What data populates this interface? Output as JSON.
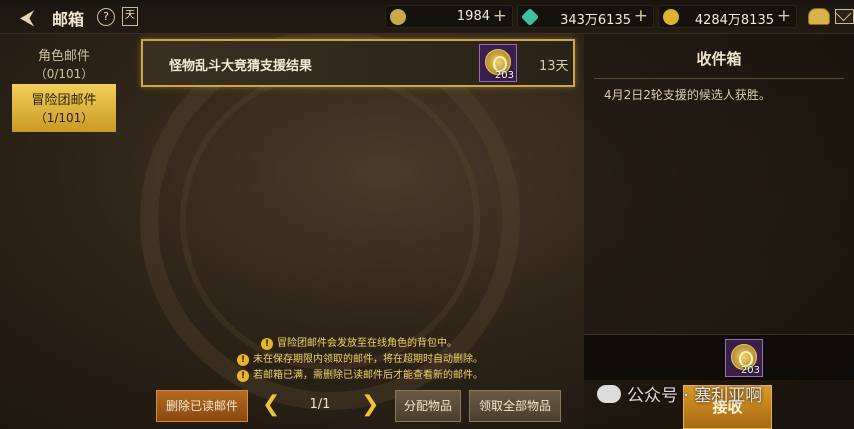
{
  "header": {
    "title": "邮箱",
    "help_icon": "question-icon",
    "calendar_icon": "calendar-icon",
    "calendar_glyph": "天",
    "resources": [
      {
        "icon": "c-token-icon",
        "value": "1984",
        "color": "#c9a84a"
      },
      {
        "icon": "crystal-icon",
        "value": "343万6135",
        "color": "#3fc0a0"
      },
      {
        "icon": "gold-coin-icon",
        "value": "4284万8135",
        "color": "#e0b030"
      }
    ]
  },
  "tabs": [
    {
      "label": "角色邮件",
      "count": "（0/101）",
      "selected": false
    },
    {
      "label": "冒险团邮件",
      "count": "（1/101）",
      "selected": true
    }
  ],
  "mails": [
    {
      "subject": "怪物乱斗大竞猜支援结果",
      "item_count": "203",
      "days_left": "13天"
    }
  ],
  "inbox": {
    "title": "收件箱",
    "body": "4月2日2轮支援的候选人获胜。",
    "attachment_count": "203",
    "receive_label": "接收"
  },
  "notices": [
    "冒险团邮件会发放至在线角色的背包中。",
    "未在保存期限内领取的邮件，将在超期时自动删除。",
    "若邮箱已满，需删除已读邮件后才能查看新的邮件。"
  ],
  "footer": {
    "delete_read_label": "删除已读邮件",
    "page": "1/1",
    "distribute_label": "分配物品",
    "claim_all_label": "领取全部物品"
  },
  "watermark": "公众号 · 塞利亚啊"
}
